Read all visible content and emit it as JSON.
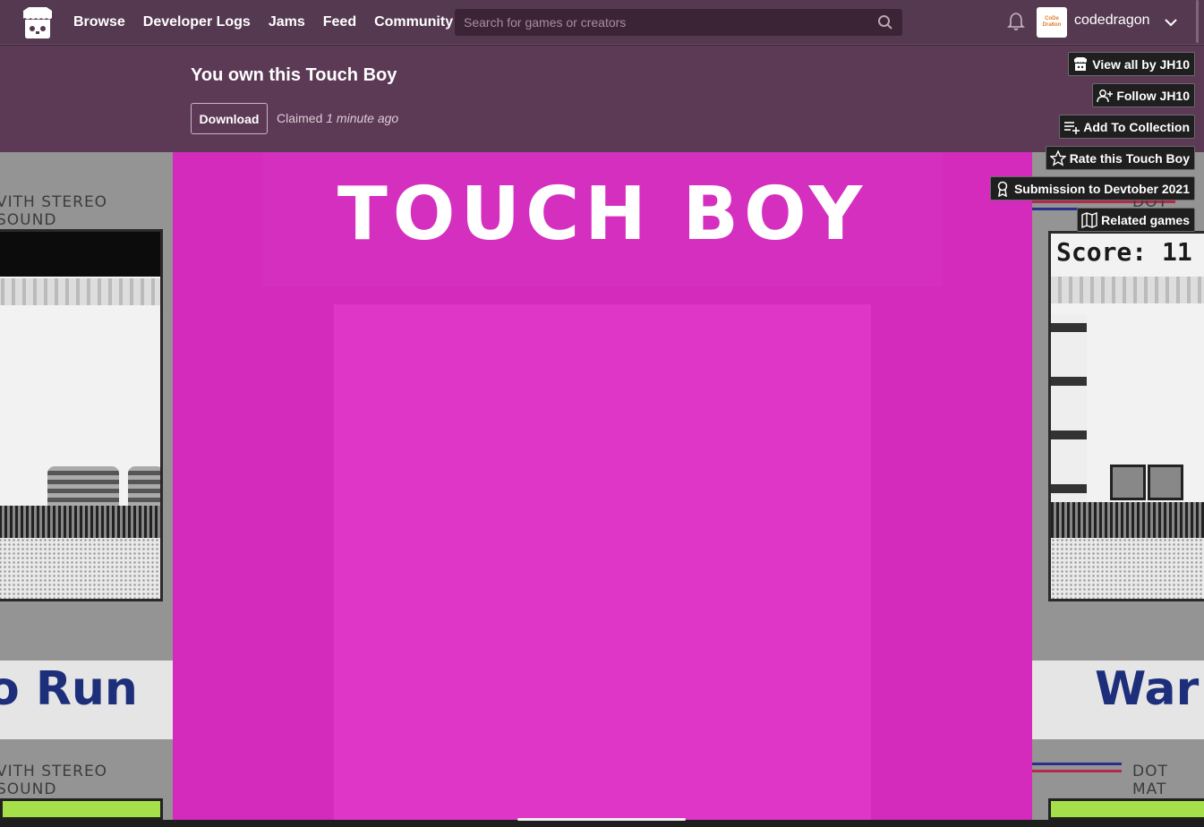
{
  "nav": {
    "links": [
      "Browse",
      "Developer Logs",
      "Jams",
      "Feed",
      "Community"
    ],
    "search_placeholder": "Search for games or creators",
    "username": "codedragon",
    "avatar_text": [
      "CoDe",
      "Dra6on"
    ]
  },
  "ownbar": {
    "title": "You own this Touch Boy",
    "download_label": "Download",
    "claimed_prefix": "Claimed",
    "claimed_time": "1 minute ago"
  },
  "actions": {
    "view_all": "View all by JH10",
    "follow": "Follow JH10",
    "add_collection": "Add To Collection",
    "rate": "Rate this Touch Boy",
    "submission": "Submission to Devtober 2021",
    "related": "Related games"
  },
  "game": {
    "title": "TOUCH BOY"
  },
  "background": {
    "left_label": "VITH STEREO SOUND",
    "left_label_bottom": "VITH STEREO SOUND",
    "left_title": "o Run",
    "right_score": "Score: 11",
    "right_title": "War",
    "right_label": "DOT MAT",
    "right_label_top": "DOT MAT"
  },
  "colors": {
    "nav_bg": "#553950",
    "ownbar_bg": "#5c3a56",
    "game_bg": "#d42bbd",
    "game_panel": "#e036c8"
  }
}
